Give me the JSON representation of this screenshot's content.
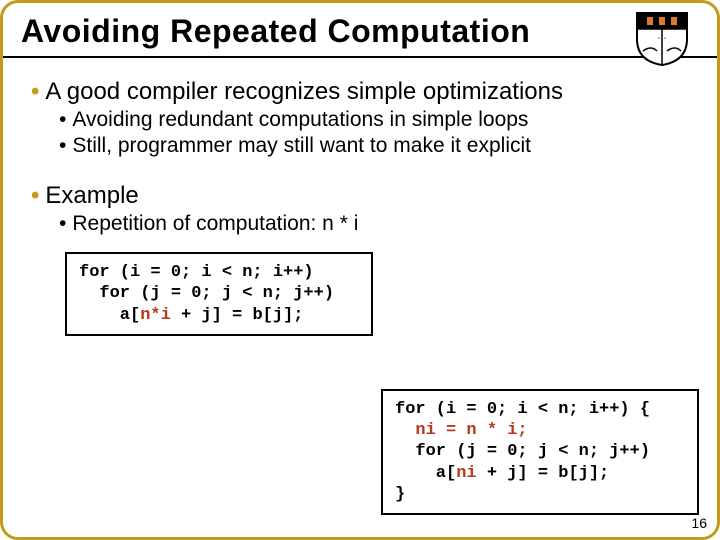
{
  "slide": {
    "title": "Avoiding Repeated Computation",
    "page_number": "16",
    "crest_alt": "princeton-shield"
  },
  "bullets": {
    "b1_1": "A good compiler recognizes simple optimizations",
    "b1_1_children": {
      "a": "Avoiding redundant computations in simple loops",
      "b": "Still, programmer may still want to make it explicit"
    },
    "b1_2": "Example",
    "b1_2_children": {
      "a": "Repetition of computation: n * i"
    }
  },
  "code": {
    "c1": {
      "l1_a": "for (i = 0; i < n; i++)",
      "l2_a": "  for (j = 0; j < n; j++)",
      "l3_a": "    a[",
      "l3_hl": "n*i",
      "l3_b": " + j] = b[j];"
    },
    "c2": {
      "l1_a": "for (i = 0; i < n; i++) {",
      "l2_a": "  ",
      "l2_hl": "ni = n * i;",
      "l3_a": "  for (j = 0; j < n; j++)",
      "l4_a": "    a[",
      "l4_hl": "ni",
      "l4_b": " + j] = b[j];",
      "l5_a": "}"
    }
  }
}
